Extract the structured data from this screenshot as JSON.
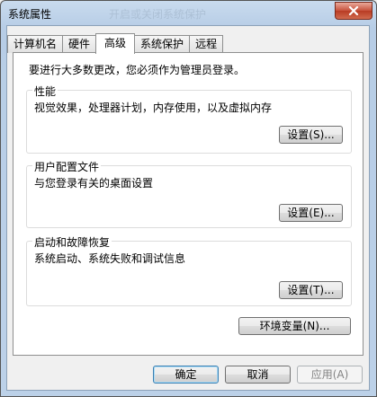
{
  "window": {
    "title": "系统属性",
    "ghost_title": "开启或关闭系统保护"
  },
  "tabs": [
    {
      "label": "计算机名",
      "active": false
    },
    {
      "label": "硬件",
      "active": false
    },
    {
      "label": "高级",
      "active": true
    },
    {
      "label": "系统保护",
      "active": false
    },
    {
      "label": "远程",
      "active": false
    }
  ],
  "advanced": {
    "admin_note": "要进行大多数更改，您必须作为管理员登录。",
    "performance": {
      "title": "性能",
      "description": "视觉效果，处理器计划，内存使用，以及虚拟内存",
      "button": "设置(S)..."
    },
    "user_profiles": {
      "title": "用户配置文件",
      "description": "与您登录有关的桌面设置",
      "button": "设置(E)..."
    },
    "startup_recovery": {
      "title": "启动和故障恢复",
      "description": "系统启动、系统失败和调试信息",
      "button": "设置(T)..."
    },
    "env_vars_button": "环境变量(N)..."
  },
  "footer": {
    "ok": "确定",
    "cancel": "取消",
    "apply": "应用(A)"
  }
}
